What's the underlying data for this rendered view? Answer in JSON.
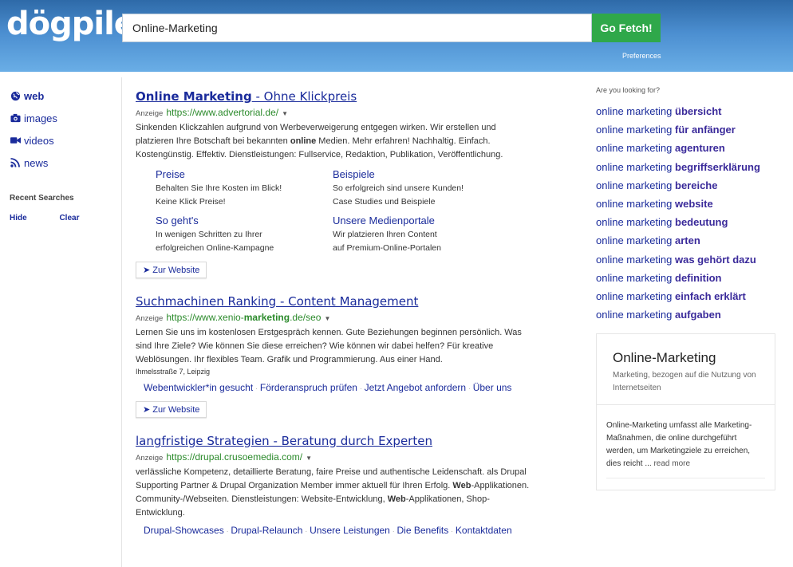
{
  "header": {
    "logo": "dögpile",
    "logo_mark": "®",
    "search_value": "Online-Marketing",
    "go_button": "Go Fetch!",
    "preferences": "Preferences"
  },
  "leftnav": {
    "items": [
      {
        "label": "web",
        "icon": "globe-icon"
      },
      {
        "label": "images",
        "icon": "camera-icon"
      },
      {
        "label": "videos",
        "icon": "video-camera-icon"
      },
      {
        "label": "news",
        "icon": "rss-icon"
      }
    ],
    "recent_title": "Recent Searches",
    "hide": "Hide",
    "clear": "Clear"
  },
  "results": [
    {
      "title_bold": "Online Marketing",
      "title_rest": " - Ohne Klickpreis",
      "ad": "Anzeige",
      "url": "https://www.advertorial.de/",
      "desc_1": "Sinkenden Klickzahlen aufgrund von Werbeverweigerung entgegen wirken. Wir erstellen und platzieren Ihre Botschaft bei bekannten ",
      "desc_bold": "online",
      "desc_2": " Medien. Mehr erfahren! Nachhaltig. Einfach. Kostengünstig. Effektiv. Dienstleistungen: Fullservice, Redaktion, Publikation, Veröffentlichung.",
      "sitelinks": [
        {
          "title": "Preise",
          "l1": "Behalten Sie Ihre Kosten im Blick!",
          "l2": "Keine Klick Preise!"
        },
        {
          "title": "Beispiele",
          "l1": "So erfolgreich sind unsere Kunden!",
          "l2": "Case Studies und Beispiele"
        },
        {
          "title": "So geht's",
          "l1": "In wenigen Schritten zu Ihrer",
          "l2": "erfolgreichen Online-Kampagne"
        },
        {
          "title": "Unsere Medienportale",
          "l1": "Wir platzieren Ihren Content",
          "l2": "auf Premium-Online-Portalen"
        }
      ],
      "button": "Zur Website"
    },
    {
      "title": "Suchmachinen Ranking - Content Management",
      "ad": "Anzeige",
      "url_pre": "https://www.xenio-",
      "url_bold": "marketing",
      "url_post": ".de/seo",
      "desc": "Lernen Sie uns im kostenlosen Erstgespräch kennen. Gute Beziehungen beginnen persönlich. Was sind Ihre Ziele? Wie können Sie diese erreichen? Wie können wir dabei helfen? Für kreative Weblösungen. Ihr flexibles Team. Grafik und Programmierung. Aus einer Hand.",
      "address": "Ihmelsstraße 7, Leipzig",
      "links": [
        "Webentwickler*in gesucht",
        "Förderanspruch prüfen",
        "Jetzt Angebot anfordern",
        "Über uns"
      ],
      "button": "Zur Website"
    },
    {
      "title": "langfristige Strategien - Beratung durch Experten",
      "ad": "Anzeige",
      "url": "https://drupal.crusoemedia.com/",
      "desc_1": "verlässliche Kompetenz, detaillierte Beratung, faire Preise und authentische Leidenschaft. als Drupal Supporting Partner & Drupal Organization Member immer aktuell für Ihren Erfolg. ",
      "desc_b1": "Web",
      "desc_2": "-Applikationen. Community-/Webseiten. Dienstleistungen: Website-Entwicklung, ",
      "desc_b2": "Web",
      "desc_3": "-Applikationen, Shop-Entwicklung.",
      "links": [
        "Drupal-Showcases",
        "Drupal-Relaunch",
        "Unsere Leistungen",
        "Die Benefits",
        "Kontaktdaten"
      ]
    }
  ],
  "related": {
    "title": "Are you looking for?",
    "prefix": "online marketing ",
    "items": [
      "übersicht",
      "für anfänger",
      "agenturen",
      "begriffserklärung",
      "bereiche",
      "website",
      "bedeutung",
      "arten",
      "was gehört dazu",
      "definition",
      "einfach erklärt",
      "aufgaben"
    ]
  },
  "knowledge": {
    "title": "Online-Marketing",
    "subtitle": "Marketing, bezogen auf die Nutzung von Internetseiten",
    "body": "Online-Marketing umfasst alle Marketing-Maßnahmen, die online durchgeführt werden, um Marketingziele zu erreichen, dies reicht ... ",
    "more": "read more"
  },
  "colors": {
    "link": "#1a2b9b",
    "url_green": "#2b8a2b",
    "go_button": "#2fa84a",
    "header_blue": "#4b8ed0"
  }
}
